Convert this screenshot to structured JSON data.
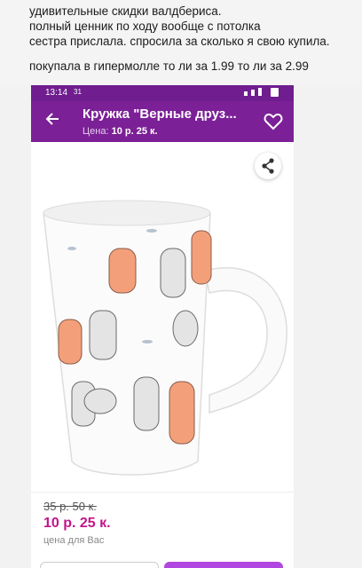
{
  "post": {
    "lines": [
      "удивительные скидки валдбериса.",
      "полный ценник по ходу вообще с потолка",
      "сестра прислала. спросила за сколько я свою купила.",
      "покупала в гипермолле то ли за 1.99 то ли за 2.99"
    ]
  },
  "status": {
    "time": "13:14",
    "extra": "31",
    "icons": "wifi-icon signal-icon battery-icon"
  },
  "appbar": {
    "title": "Кружка \"Верные друз...",
    "price_label": "Цена:",
    "price": "10 р. 25 к.",
    "icons": [
      "back-arrow-icon",
      "heart-icon"
    ]
  },
  "gallery": {
    "slides": 4,
    "active": 0,
    "icons": [
      "share-icon"
    ]
  },
  "price_block": {
    "old": "35 р. 50 к.",
    "new": "10 р. 25 к.",
    "caption": "цена для Вас"
  },
  "colors": {
    "brand": "#7b2096",
    "price": "#c2148a",
    "accent": "#b146e0"
  }
}
